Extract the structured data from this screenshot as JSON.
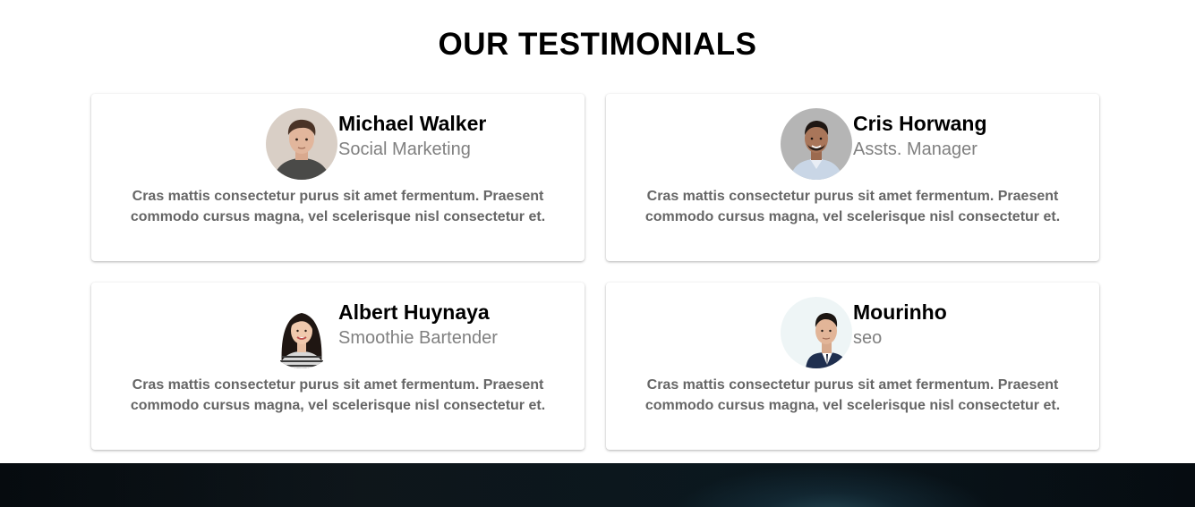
{
  "section": {
    "title": "OUR TESTIMONIALS"
  },
  "testimonials": [
    {
      "name": "Michael Walker",
      "role": "Social Marketing",
      "quote": "Cras mattis consectetur purus sit amet fermentum. Praesent commodo cursus magna, vel scelerisque nisl consectetur et.",
      "avatar": "young-man-dark-tshirt-photo"
    },
    {
      "name": "Cris Horwang",
      "role": "Assts. Manager",
      "quote": "Cras mattis consectetur purus sit amet fermentum. Praesent commodo cursus magna, vel scelerisque nisl consectetur et.",
      "avatar": "smiling-man-light-shirt-photo"
    },
    {
      "name": "Albert Huynaya",
      "role": "Smoothie Bartender",
      "quote": "Cras mattis consectetur purus sit amet fermentum. Praesent commodo cursus magna, vel scelerisque nisl consectetur et.",
      "avatar": "smiling-woman-striped-top-photo"
    },
    {
      "name": "Mourinho",
      "role": "seo",
      "quote": "Cras mattis consectetur purus sit amet fermentum. Praesent commodo cursus magna, vel scelerisque nisl consectetur et.",
      "avatar": "man-navy-suit-photo"
    }
  ],
  "colors": {
    "name": "#000000",
    "role": "#808080",
    "quote": "#666666",
    "footer": "#04080b"
  }
}
